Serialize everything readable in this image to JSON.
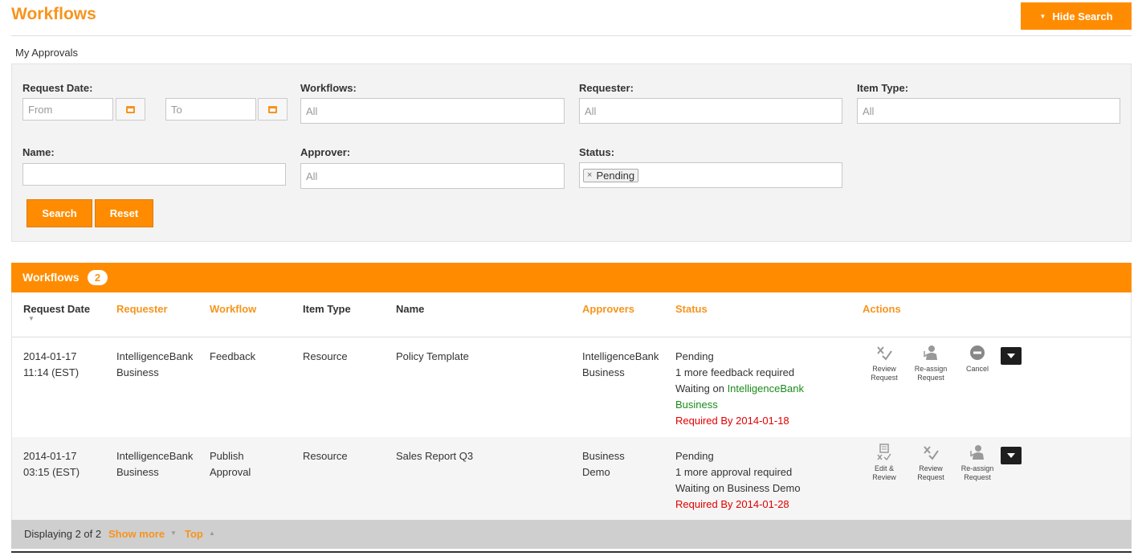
{
  "header": {
    "title": "Workflows",
    "hide_search_label": "Hide Search"
  },
  "breadcrumb": "My Approvals",
  "search": {
    "request_date_label": "Request Date:",
    "from_placeholder": "From",
    "to_placeholder": "To",
    "workflows_label": "Workflows:",
    "workflows_value": "All",
    "requester_label": "Requester:",
    "requester_value": "All",
    "item_type_label": "Item Type:",
    "item_type_value": "All",
    "name_label": "Name:",
    "name_value": "",
    "approver_label": "Approver:",
    "approver_value": "All",
    "status_label": "Status:",
    "status_tag": "Pending",
    "status_tag_remove": "×",
    "search_button": "Search",
    "reset_button": "Reset"
  },
  "results": {
    "title": "Workflows",
    "count": "2",
    "columns": {
      "request_date": "Request Date",
      "requester": "Requester",
      "workflow": "Workflow",
      "item_type": "Item Type",
      "name": "Name",
      "approvers": "Approvers",
      "status": "Status",
      "actions": "Actions"
    },
    "rows": [
      {
        "date_line1": "2014-01-17",
        "date_line2": "11:14 (EST)",
        "requester_line1": "IntelligenceBank",
        "requester_line2": "Business",
        "workflow_line1": "Feedback",
        "workflow_line2": "",
        "item_type": "Resource",
        "name": "Policy Template",
        "approvers_line1": "IntelligenceBank",
        "approvers_line2": "Business",
        "status": "Pending",
        "status_detail": "1 more feedback required",
        "waiting_prefix": "Waiting on",
        "waiting_on_line1": "IntelligenceBank",
        "waiting_on_line2": "Business",
        "required_by": "Required By 2014-01-18",
        "actions": [
          {
            "label_line1": "Review",
            "label_line2": "Request",
            "icon": "review-icon"
          },
          {
            "label_line1": "Re-assign",
            "label_line2": "Request",
            "icon": "reassign-icon"
          },
          {
            "label_line1": "Cancel",
            "label_line2": "",
            "icon": "cancel-icon"
          }
        ]
      },
      {
        "date_line1": "2014-01-17",
        "date_line2": "03:15 (EST)",
        "requester_line1": "IntelligenceBank",
        "requester_line2": "Business",
        "workflow_line1": "Publish",
        "workflow_line2": "Approval",
        "item_type": "Resource",
        "name": "Sales Report Q3",
        "approvers_line1": "Business",
        "approvers_line2": "Demo",
        "status": "Pending",
        "status_detail": "1 more approval required",
        "waiting_text": "Waiting on Business Demo",
        "required_by": "Required By 2014-01-28",
        "actions": [
          {
            "label_line1": "Edit &",
            "label_line2": "Review",
            "icon": "edit-review-icon"
          },
          {
            "label_line1": "Review",
            "label_line2": "Request",
            "icon": "review-icon"
          },
          {
            "label_line1": "Re-assign",
            "label_line2": "Request",
            "icon": "reassign-icon"
          }
        ]
      }
    ]
  },
  "footer": {
    "displaying": "Displaying 2 of 2",
    "show_more": "Show more",
    "top": "Top"
  },
  "colors": {
    "accent": "#ff8c00",
    "link": "#f7941d",
    "green": "#1a8a1a",
    "red": "#e00000"
  }
}
